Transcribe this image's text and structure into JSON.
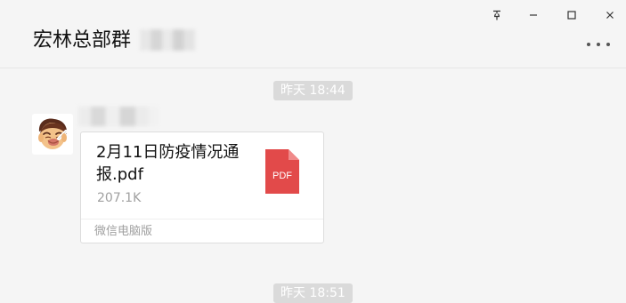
{
  "window": {
    "group_title": "宏林总部群"
  },
  "conversation": {
    "timestamps": [
      "昨天 18:44",
      "昨天 18:51"
    ],
    "message": {
      "file_name": "2月11日防疫情况通报.pdf",
      "file_size": "207.1K",
      "file_type_label": "PDF",
      "footer_label": "微信电脑版",
      "icon": "pdf-file-icon"
    }
  },
  "colors": {
    "background": "#f5f5f5",
    "pdf_red": "#e24a4a",
    "timestamp_badge": "#dadada"
  }
}
